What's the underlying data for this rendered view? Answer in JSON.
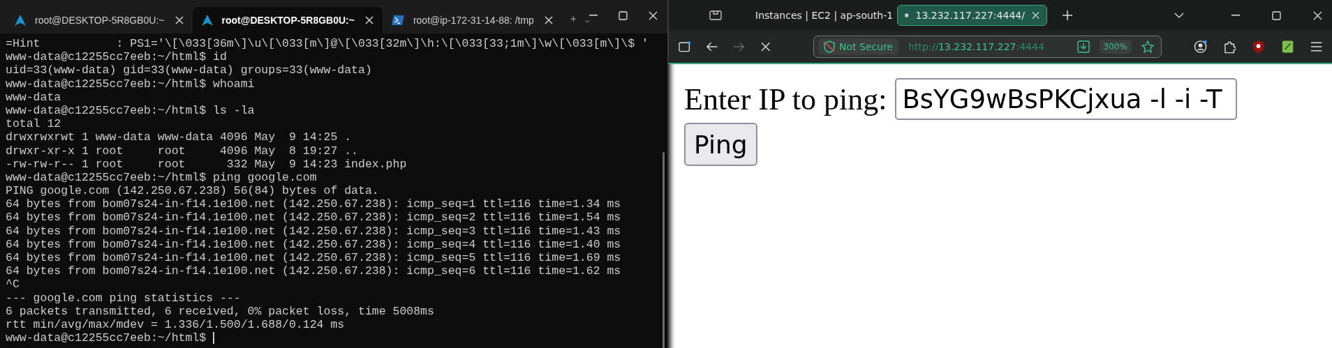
{
  "terminal": {
    "tabs": [
      {
        "label": "root@DESKTOP-5R8GB0U:~",
        "selected": false,
        "kind": "linux"
      },
      {
        "label": "root@DESKTOP-5R8GB0U:~",
        "selected": true,
        "kind": "linux"
      },
      {
        "label": "root@ip-172-31-14-88: /tmp",
        "selected": false,
        "kind": "powershell"
      }
    ],
    "lines": [
      "=Hint           : PS1='\\[\\033[36m\\]\\u\\[\\033[m\\]@\\[\\033[32m\\]\\h:\\[\\033[33;1m\\]\\w\\[\\033[m\\]\\$ '",
      "www-data@c12255cc7eeb:~/html$ id",
      "uid=33(www-data) gid=33(www-data) groups=33(www-data)",
      "www-data@c12255cc7eeb:~/html$ whoami",
      "www-data",
      "www-data@c12255cc7eeb:~/html$ ls -la",
      "total 12",
      "drwxrwxrwt 1 www-data www-data 4096 May  9 14:25 .",
      "drwxr-xr-x 1 root     root     4096 May  8 19:27 ..",
      "-rw-rw-r-- 1 root     root      332 May  9 14:23 index.php",
      "www-data@c12255cc7eeb:~/html$ ping google.com",
      "PING google.com (142.250.67.238) 56(84) bytes of data.",
      "64 bytes from bom07s24-in-f14.1e100.net (142.250.67.238): icmp_seq=1 ttl=116 time=1.34 ms",
      "64 bytes from bom07s24-in-f14.1e100.net (142.250.67.238): icmp_seq=2 ttl=116 time=1.54 ms",
      "64 bytes from bom07s24-in-f14.1e100.net (142.250.67.238): icmp_seq=3 ttl=116 time=1.43 ms",
      "64 bytes from bom07s24-in-f14.1e100.net (142.250.67.238): icmp_seq=4 ttl=116 time=1.40 ms",
      "64 bytes from bom07s24-in-f14.1e100.net (142.250.67.238): icmp_seq=5 ttl=116 time=1.69 ms",
      "64 bytes from bom07s24-in-f14.1e100.net (142.250.67.238): icmp_seq=6 ttl=116 time=1.62 ms",
      "^C",
      "--- google.com ping statistics ---",
      "6 packets transmitted, 6 received, 0% packet loss, time 5008ms",
      "rtt min/avg/max/mdev = 1.336/1.500/1.688/0.124 ms",
      "www-data@c12255cc7eeb:~/html$"
    ]
  },
  "browser": {
    "tabs": [
      {
        "title": "Instances | EC2 | ap-south-1",
        "selected": false,
        "kind": "site"
      },
      {
        "title": "13.232.117.227:4444/",
        "selected": true,
        "kind": "dot"
      }
    ],
    "address": {
      "security": "Not Secure",
      "scheme": "http://",
      "host": "13.232.117.227",
      "port": ":4444",
      "zoom": "300%"
    },
    "page": {
      "label": "Enter IP to ping:",
      "input_value": "BsYG9wBsPKCjxua -l -i -T",
      "button": "Ping"
    }
  }
}
